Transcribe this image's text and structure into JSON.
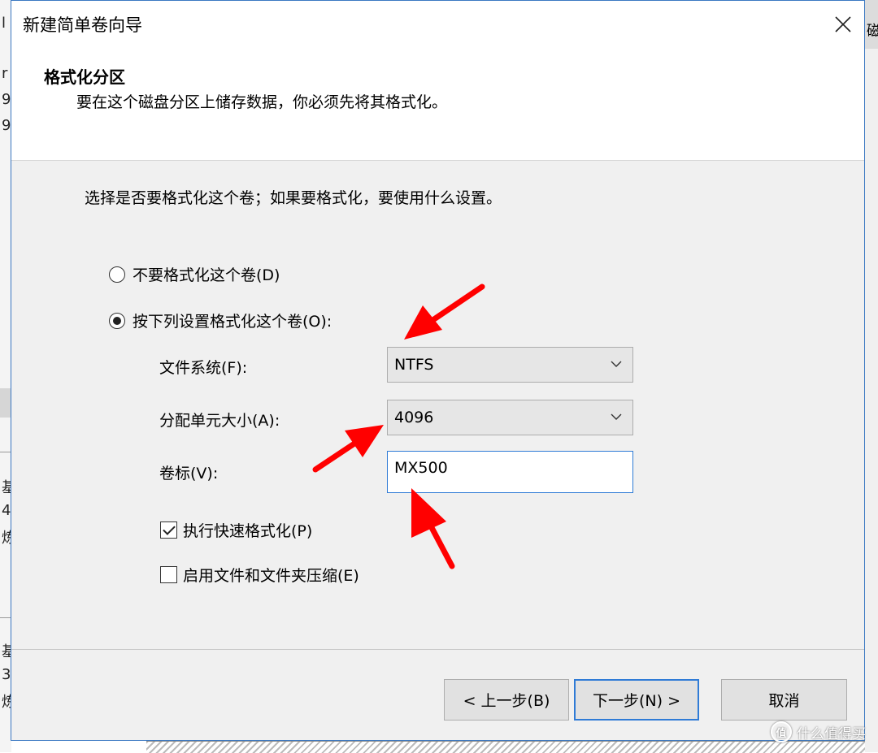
{
  "dialog": {
    "title": "新建简单卷向导",
    "header_title": "格式化分区",
    "header_subtitle": "要在这个磁盘分区上储存数据，你必须先将其格式化。",
    "instruction": "选择是否要格式化这个卷；如果要格式化，要使用什么设置。"
  },
  "options": {
    "no_format": "不要格式化这个卷(D)",
    "format": "按下列设置格式化这个卷(O):",
    "selected": "format"
  },
  "fields": {
    "filesystem_label": "文件系统(F):",
    "filesystem_value": "NTFS",
    "alloc_label": "分配单元大小(A):",
    "alloc_value": "4096",
    "volume_label": "卷标(V):",
    "volume_value": "MX500",
    "quick_format": "执行快速格式化(P)",
    "quick_format_checked": true,
    "compression": "启用文件和文件夹压缩(E)",
    "compression_checked": false
  },
  "buttons": {
    "back": "< 上一步(B)",
    "next": "下一步(N) >",
    "cancel": "取消"
  },
  "background": {
    "left_fragments": [
      "l",
      "r",
      "9",
      "9",
      "基",
      "4",
      "炼",
      "基",
      "3",
      "炼"
    ],
    "right_fragment": "磁"
  },
  "watermark": {
    "logo": "值",
    "text": "什么值得买"
  },
  "colors": {
    "annotation_arrow": "#ff0000",
    "accent": "#2f7bd6"
  }
}
